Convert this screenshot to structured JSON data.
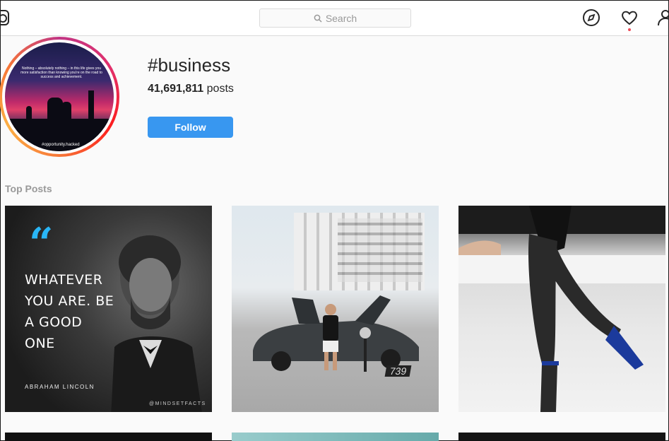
{
  "search": {
    "placeholder": "Search"
  },
  "icons": {
    "logo": "instagram-logo-icon",
    "explore": "compass-icon",
    "activity": "heart-icon",
    "profile": "person-icon"
  },
  "colors": {
    "follow_button": "#3897f0",
    "notification_dot": "#ed4956",
    "quote_mark": "#29b6f6"
  },
  "avatar": {
    "quote": "Nothing – absolutely nothing – in this life gives you more satisfaction than knowing you're on the road to success and achievement.",
    "handle": "#opportunity.hacked"
  },
  "hashtag": {
    "title": "#business",
    "post_count": "41,691,811",
    "post_label": " posts",
    "follow_label": "Follow"
  },
  "top_posts": {
    "heading": "Top Posts",
    "post1": {
      "quote_mark": "“",
      "text": "WHATEVER YOU ARE. BE A GOOD ONE",
      "author": "ABRAHAM LINCOLN",
      "handle": "@MINDSETFACTS"
    },
    "post2": {
      "plate": "739"
    }
  }
}
